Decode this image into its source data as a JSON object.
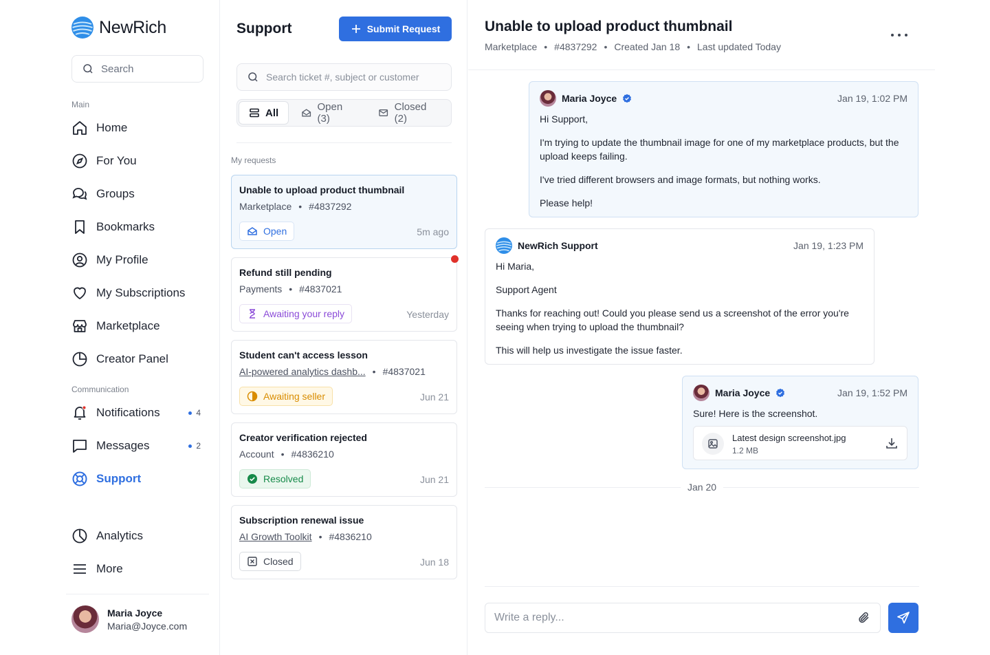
{
  "brand": {
    "name": "NewRich"
  },
  "sidebar": {
    "search_placeholder": "Search",
    "main_label": "Main",
    "communication_label": "Communication",
    "main_items": [
      {
        "label": "Home",
        "icon": "home-icon"
      },
      {
        "label": "For You",
        "icon": "compass-icon"
      },
      {
        "label": "Groups",
        "icon": "chat-bubbles-icon"
      },
      {
        "label": "Bookmarks",
        "icon": "bookmark-icon"
      },
      {
        "label": "My Profile",
        "icon": "user-circle-icon"
      },
      {
        "label": "My Subscriptions",
        "icon": "heart-icon"
      },
      {
        "label": "Marketplace",
        "icon": "store-icon"
      },
      {
        "label": "Creator Panel",
        "icon": "pie-chart-icon"
      }
    ],
    "comm_items": [
      {
        "label": "Notifications",
        "icon": "bell-icon",
        "count": "4"
      },
      {
        "label": "Messages",
        "icon": "message-icon",
        "count": "2"
      },
      {
        "label": "Support",
        "icon": "lifebuoy-icon",
        "active": true
      }
    ],
    "bottom_items": [
      {
        "label": "Analytics",
        "icon": "analytics-icon"
      },
      {
        "label": "More",
        "icon": "menu-icon"
      }
    ],
    "user": {
      "name": "Maria Joyce",
      "email": "Maria@Joyce.com"
    }
  },
  "support": {
    "title": "Support",
    "submit_label": "Submit Request",
    "search_placeholder": "Search ticket #, subject or customer",
    "filters": [
      {
        "label": "All",
        "active": true
      },
      {
        "label": "Open (3)"
      },
      {
        "label": "Closed (2)"
      }
    ],
    "my_requests_label": "My requests",
    "tickets": [
      {
        "title": "Unable to upload product thumbnail",
        "category": "Marketplace",
        "id": "#4837292",
        "status": "Open",
        "time": "5m ago"
      },
      {
        "title": "Refund still pending",
        "category": "Payments",
        "id": "#4837021",
        "status": "Awaiting your reply",
        "time": "Yesterday",
        "unread": true
      },
      {
        "title": "Student can't access lesson",
        "category": "AI-powered analytics dashb...",
        "id": "#4837021",
        "status": "Awaiting seller",
        "time": "Jun 21"
      },
      {
        "title": "Creator verification rejected",
        "category": "Account",
        "id": "#4836210",
        "status": "Resolved",
        "time": "Jun 21"
      },
      {
        "title": "Subscription renewal issue",
        "category": "AI Growth Toolkit",
        "id": "#4836210",
        "status": "Closed",
        "time": "Jun 18"
      }
    ]
  },
  "conversation": {
    "title": "Unable to upload product thumbnail",
    "meta": {
      "category": "Marketplace",
      "id": "#4837292",
      "created": "Created Jan 18",
      "updated": "Last updated Today"
    },
    "messages": [
      {
        "author": "Maria Joyce",
        "time": "Jan 19, 1:02 PM",
        "lines": [
          "Hi Support,",
          "I'm trying to update the thumbnail image for one of my marketplace products, but the upload keeps failing.",
          "I've tried different browsers and image formats, but nothing works.",
          "Please help!"
        ]
      },
      {
        "author": "NewRich Support",
        "time": "Jan 19, 1:23 PM",
        "lines": [
          "Hi Maria,",
          "Support Agent",
          "Thanks for reaching out! Could you please send us a screenshot of the error you're seeing when trying to upload the thumbnail?",
          "This will help us investigate the issue faster."
        ]
      },
      {
        "author": "Maria Joyce",
        "time": "Jan 19, 1:52 PM",
        "lines": [
          "Sure! Here is the screenshot."
        ],
        "attachment": {
          "name": "Latest design screenshot.jpg",
          "size": "1.2 MB"
        }
      }
    ],
    "date_separator": "Jan 20",
    "reply_placeholder": "Write a reply..."
  },
  "colors": {
    "accent": "#2f6fe0",
    "unread": "#e0312a",
    "resolved": "#178a4a",
    "awaiting": "#8b4bd8",
    "seller": "#d98c00"
  }
}
